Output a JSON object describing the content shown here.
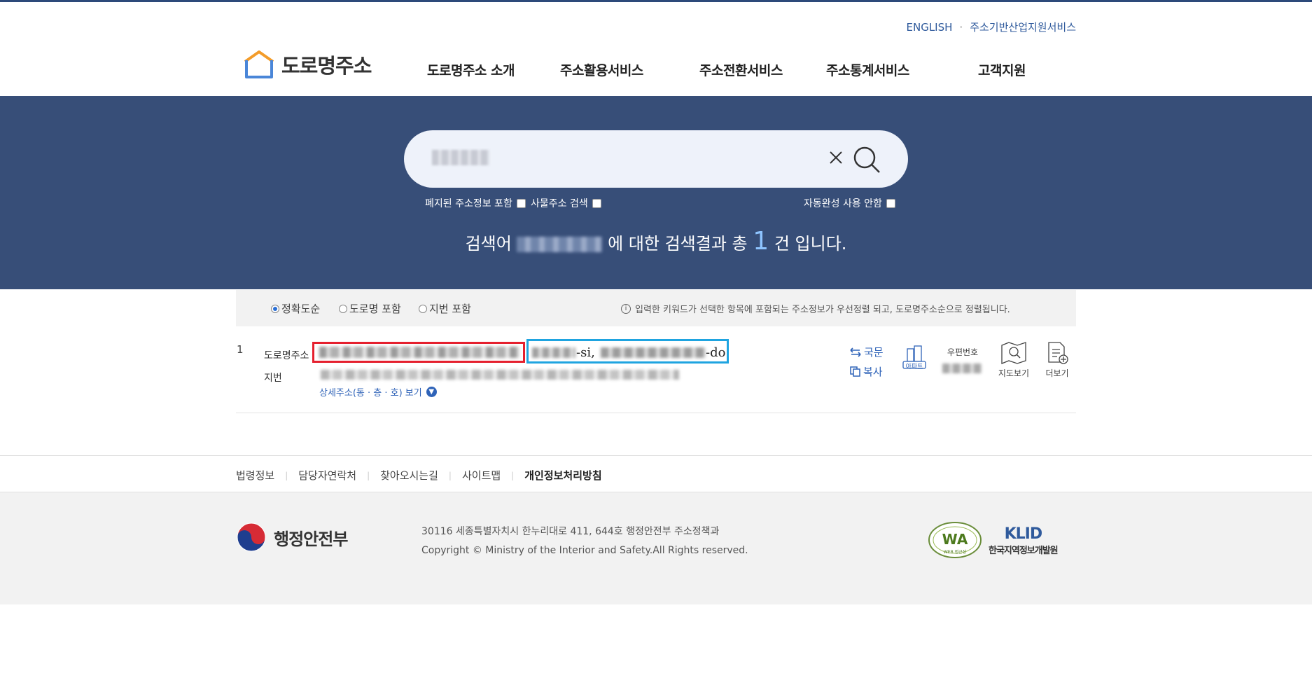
{
  "header": {
    "util_links": [
      "ENGLISH",
      "주소기반산업지원서비스"
    ],
    "logo_text": "도로명주소",
    "nav": [
      "도로명주소 소개",
      "주소활용서비스",
      "주소전환서비스",
      "주소통계서비스",
      "고객지원"
    ]
  },
  "search": {
    "options": [
      "폐지된 주소정보 포함",
      "사물주소 검색",
      "자동완성 사용 안함"
    ],
    "summary_prefix": "검색어",
    "summary_mid": "에 대한 검색결과 총",
    "summary_count": "1",
    "summary_suffix": "건 입니다."
  },
  "sort": {
    "options": [
      "정확도순",
      "도로명 포함",
      "지번 포함"
    ],
    "selected": "정확도순",
    "note_icon": "i",
    "note": "입력한 키워드가 선택한 항목에 포함되는 주소정보가 우선정렬 되고, 도로명주소순으로 정렬됩니다."
  },
  "results": [
    {
      "index": "1",
      "road_label": "도로명주소",
      "road_english_tail_1": "-si,",
      "road_english_tail_2": "-do",
      "jibun_label": "지번",
      "detail_link": "상세주소(동 · 층 · 호) 보기",
      "actions": [
        "국문",
        "복사"
      ],
      "tools": [
        "아파트",
        "우편번호",
        "지도보기",
        "더보기"
      ]
    }
  ],
  "footer": {
    "links": [
      "법령정보",
      "담당자연락처",
      "찾아오시는길",
      "사이트맵",
      "개인정보처리방침"
    ],
    "org": "행정안전부",
    "address": "30116 세종특별자치시 한누리대로 411, 644호 행정안전부 주소정책과",
    "copyright": "Copyright © Ministry of the Interior and Safety.All Rights reserved.",
    "wa_label": "WA",
    "wa_sub": "WEB 접근성",
    "klid_top": "KLID",
    "klid_bottom": "한국지역정보개발원"
  },
  "colors": {
    "hero_bg": "#374e78",
    "link_blue": "#2f63b8",
    "highlight_red": "#e5202e",
    "highlight_blue": "#1fa4e0"
  }
}
